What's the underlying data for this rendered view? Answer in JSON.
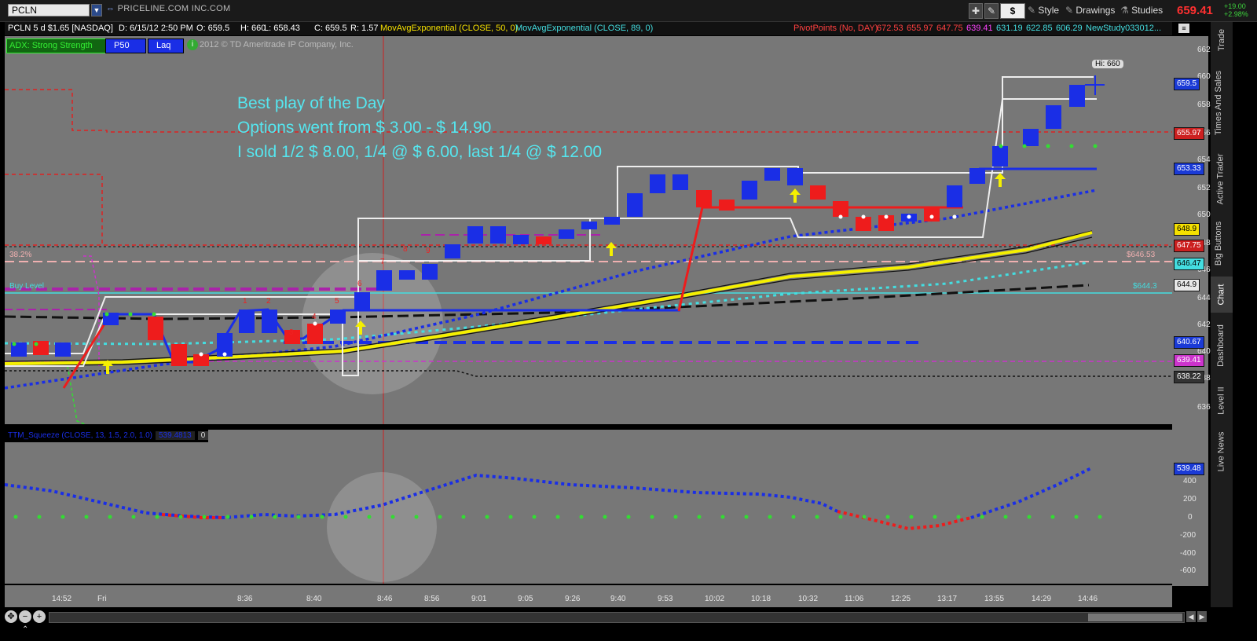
{
  "topbar": {
    "symbol": "PCLN",
    "company": "PRICELINE.COM INC.COM",
    "dollar_label": "$",
    "style_label": "Style",
    "drawings_label": "Drawings",
    "studies_label": "Studies",
    "last_price": "659.41",
    "change_abs": "+19.00",
    "change_pct": "+2.98%"
  },
  "infobar": {
    "symbol_period": "PCLN 5 d $1.65 [NASDAQ]",
    "date": "D: 6/15/12 2:50 PM",
    "open": "O: 659.5",
    "high": "H: 660",
    "low": "L: 658.43",
    "close": "C: 659.5",
    "range": "R: 1.57",
    "ema50": "MovAvgExponential (CLOSE, 50, 0)",
    "ema89": "MovAvgExponential (CLOSE, 89, 0)",
    "pivot_label": "PivotPoints (No, DAY)",
    "pivots": [
      "672.53",
      "655.97",
      "647.75",
      "639.41",
      "631.19",
      "622.85",
      "606.29"
    ],
    "new_study": "NewStudy033012..."
  },
  "studybar": {
    "adx": "ADX: Strong Strength",
    "p50": "P50",
    "laq": "Laq",
    "copyright": "2012 © TD Ameritrade IP Company, Inc."
  },
  "annotation": {
    "line1": "Best play of the Day",
    "line2": "Options went from $ 3.00 - $ 14.90",
    "line3": "I sold 1/2 $ 8.00, 1/4 @ $ 6.00, last 1/4 @ $ 12.00"
  },
  "labels": {
    "fib": "38.2%",
    "buy_level": "Buy Level",
    "hi_bubble": "Hi: 660",
    "level_64653": "$646.53",
    "level_6443": "$644.3"
  },
  "subchart": {
    "title": "TTM_Squeeze (CLOSE, 13, 1.5, 2.0, 1.0)",
    "value": "539.4813",
    "zero": "0"
  },
  "price_axis": {
    "ticks": [
      "662",
      "660",
      "658",
      "656",
      "654",
      "652",
      "650",
      "648",
      "646",
      "644",
      "642",
      "640",
      "638",
      "636"
    ],
    "tags": [
      {
        "text": "659.5",
        "color": "#1a3ad6",
        "fg": "#ffffff"
      },
      {
        "text": "655.97",
        "color": "#cc2020",
        "fg": "#ffffff"
      },
      {
        "text": "653.33",
        "color": "#1a3ad6",
        "fg": "#ffffff"
      },
      {
        "text": "648.9",
        "color": "#f5e000",
        "fg": "#000000"
      },
      {
        "text": "647.75",
        "color": "#cc2020",
        "fg": "#ffffff"
      },
      {
        "text": "646.47",
        "color": "#44dde0",
        "fg": "#000000"
      },
      {
        "text": "644.9",
        "color": "#e8e8e8",
        "fg": "#000000"
      },
      {
        "text": "640.67",
        "color": "#1a3ad6",
        "fg": "#ffffff"
      },
      {
        "text": "639.41",
        "color": "#cc33cc",
        "fg": "#ffffff"
      },
      {
        "text": "638.22",
        "color": "#333333",
        "fg": "#ffffff"
      }
    ]
  },
  "sub_axis": {
    "ticks": [
      "400",
      "200",
      "0",
      "-200",
      "-400",
      "-600"
    ],
    "tag": "539.48"
  },
  "time_axis": [
    "14:52",
    "Fri",
    "8:36",
    "8:40",
    "8:46",
    "8:56",
    "9:01",
    "9:05",
    "9:26",
    "9:40",
    "9:53",
    "10:02",
    "10:18",
    "10:32",
    "11:06",
    "12:25",
    "13:17",
    "13:55",
    "14:29",
    "14:46"
  ],
  "right_tabs": [
    "Trade",
    "Times And Sales",
    "Active Trader",
    "Big Buttons",
    "Chart",
    "Dashboard",
    "Level II",
    "Live News"
  ],
  "colors": {
    "up_bar": "#1a2ee6",
    "down_bar": "#ee1c1c",
    "annotation": "#55e6ef",
    "pivot_red": "#dd2222",
    "magenta": "#cc33cc"
  }
}
